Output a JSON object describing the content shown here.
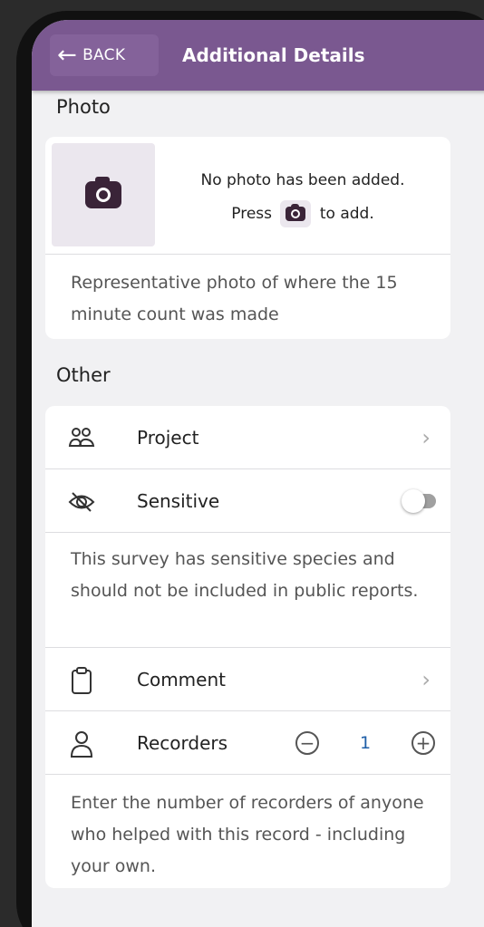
{
  "header": {
    "back_label": "BACK",
    "title": "Additional Details"
  },
  "photo_section": {
    "label": "Photo",
    "message_line1": "No photo has been added.",
    "message_press": "Press",
    "message_to_add": "to add.",
    "note": "Representative photo of where the 15 minute count was made"
  },
  "other_section": {
    "label": "Other",
    "project_label": "Project",
    "sensitive_label": "Sensitive",
    "sensitive_on": false,
    "sensitive_note": "This survey has sensitive species and should not be included in public reports.",
    "comment_label": "Comment",
    "recorders_label": "Recorders",
    "recorders_count": "1",
    "recorders_note": "Enter the number of recorders of anyone who helped with this record - including your own."
  },
  "colors": {
    "header": "#7a5890",
    "stepper_value": "#1f5fa8"
  }
}
